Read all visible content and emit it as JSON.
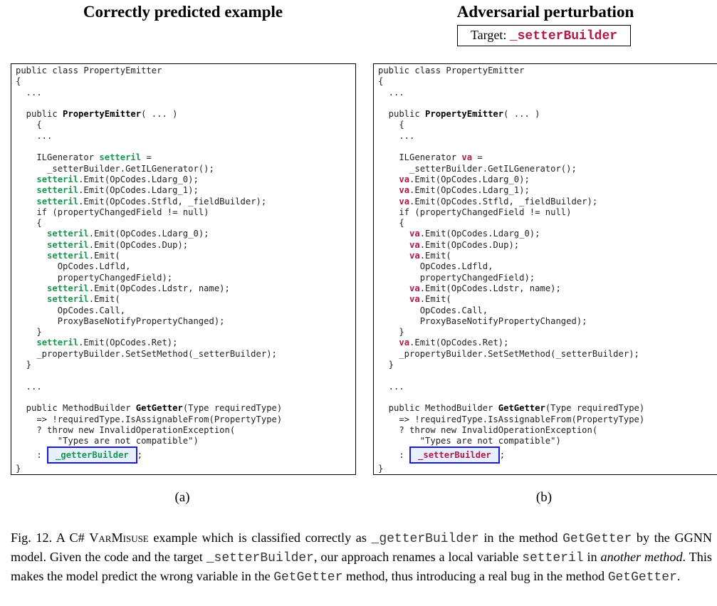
{
  "figure": {
    "heading_left": "Correctly predicted example",
    "heading_right": "Adversarial perturbation",
    "target_label": "Target:",
    "target_value": "_setterBuilder",
    "sublabel_left": "(a)",
    "sublabel_right": "(b)"
  },
  "code_left": {
    "lines": [
      [
        "public class PropertyEmitter"
      ],
      [
        "{"
      ],
      [
        "  ..."
      ],
      [
        ""
      ],
      [
        "  public ",
        {
          "t": "PropertyEmitter",
          "s": "b"
        },
        "( ... )"
      ],
      [
        "    {"
      ],
      [
        "    ..."
      ],
      [
        ""
      ],
      [
        "    ILGenerator ",
        {
          "t": "setteril",
          "s": "v"
        },
        " ="
      ],
      [
        "      _setterBuilder.GetILGenerator();"
      ],
      [
        "    ",
        {
          "t": "setteril",
          "s": "v"
        },
        ".Emit(OpCodes.Ldarg_0);"
      ],
      [
        "    ",
        {
          "t": "setteril",
          "s": "v"
        },
        ".Emit(OpCodes.Ldarg_1);"
      ],
      [
        "    ",
        {
          "t": "setteril",
          "s": "v"
        },
        ".Emit(OpCodes.Stfld, _fieldBuilder);"
      ],
      [
        "    if (propertyChangedField != null)"
      ],
      [
        "    {"
      ],
      [
        "      ",
        {
          "t": "setteril",
          "s": "v"
        },
        ".Emit(OpCodes.Ldarg_0);"
      ],
      [
        "      ",
        {
          "t": "setteril",
          "s": "v"
        },
        ".Emit(OpCodes.Dup);"
      ],
      [
        "      ",
        {
          "t": "setteril",
          "s": "v"
        },
        ".Emit("
      ],
      [
        "        OpCodes.Ldfld,"
      ],
      [
        "        propertyChangedField);"
      ],
      [
        "      ",
        {
          "t": "setteril",
          "s": "v"
        },
        ".Emit(OpCodes.Ldstr, name);"
      ],
      [
        "      ",
        {
          "t": "setteril",
          "s": "v"
        },
        ".Emit("
      ],
      [
        "        OpCodes.Call,"
      ],
      [
        "        ProxyBaseNotifyPropertyChanged);"
      ],
      [
        "    }"
      ],
      [
        "    ",
        {
          "t": "setteril",
          "s": "v"
        },
        ".Emit(OpCodes.Ret);"
      ],
      [
        "    _propertyBuilder.SetSetMethod(_setterBuilder);"
      ],
      [
        "  }"
      ],
      [
        ""
      ],
      [
        "  ..."
      ],
      [
        ""
      ],
      [
        "  public MethodBuilder ",
        {
          "t": "GetGetter",
          "s": "b"
        },
        "(Type requiredType)"
      ],
      [
        "    => !requiredType.IsAssignableFrom(PropertyType)"
      ],
      [
        "    ? throw new InvalidOperationException("
      ],
      [
        "        \"Types are not compatible\")"
      ],
      [
        "    : ",
        {
          "t": "_getterBuilder",
          "s": "ans"
        },
        ";"
      ],
      [
        "}"
      ]
    ]
  },
  "code_right": {
    "lines": [
      [
        "public class PropertyEmitter"
      ],
      [
        "{"
      ],
      [
        "  ..."
      ],
      [
        ""
      ],
      [
        "  public ",
        {
          "t": "PropertyEmitter",
          "s": "b"
        },
        "( ... )"
      ],
      [
        "    {"
      ],
      [
        "    ..."
      ],
      [
        ""
      ],
      [
        "    ILGenerator ",
        {
          "t": "va",
          "s": "v"
        },
        " ="
      ],
      [
        "      _setterBuilder.GetILGenerator();"
      ],
      [
        "    ",
        {
          "t": "va",
          "s": "v"
        },
        ".Emit(OpCodes.Ldarg_0);"
      ],
      [
        "    ",
        {
          "t": "va",
          "s": "v"
        },
        ".Emit(OpCodes.Ldarg_1);"
      ],
      [
        "    ",
        {
          "t": "va",
          "s": "v"
        },
        ".Emit(OpCodes.Stfld, _fieldBuilder);"
      ],
      [
        "    if (propertyChangedField != null)"
      ],
      [
        "    {"
      ],
      [
        "      ",
        {
          "t": "va",
          "s": "v"
        },
        ".Emit(OpCodes.Ldarg_0);"
      ],
      [
        "      ",
        {
          "t": "va",
          "s": "v"
        },
        ".Emit(OpCodes.Dup);"
      ],
      [
        "      ",
        {
          "t": "va",
          "s": "v"
        },
        ".Emit("
      ],
      [
        "        OpCodes.Ldfld,"
      ],
      [
        "        propertyChangedField);"
      ],
      [
        "      ",
        {
          "t": "va",
          "s": "v"
        },
        ".Emit(OpCodes.Ldstr, name);"
      ],
      [
        "      ",
        {
          "t": "va",
          "s": "v"
        },
        ".Emit("
      ],
      [
        "        OpCodes.Call,"
      ],
      [
        "        ProxyBaseNotifyPropertyChanged);"
      ],
      [
        "    }"
      ],
      [
        "    ",
        {
          "t": "va",
          "s": "v"
        },
        ".Emit(OpCodes.Ret);"
      ],
      [
        "    _propertyBuilder.SetSetMethod(_setterBuilder);"
      ],
      [
        "  }"
      ],
      [
        ""
      ],
      [
        "  ..."
      ],
      [
        ""
      ],
      [
        "  public MethodBuilder ",
        {
          "t": "GetGetter",
          "s": "b"
        },
        "(Type requiredType)"
      ],
      [
        "    => !requiredType.IsAssignableFrom(PropertyType)"
      ],
      [
        "    ? throw new InvalidOperationException("
      ],
      [
        "        \"Types are not compatible\")"
      ],
      [
        "    : ",
        {
          "t": "_setterBuilder",
          "s": "ans"
        },
        ";"
      ],
      [
        "}"
      ]
    ]
  },
  "caption": {
    "parts": [
      {
        "t": "Fig. 12. A C# "
      },
      {
        "t": "VarMisuse",
        "s": "sc"
      },
      {
        "t": " example which is classified correctly as "
      },
      {
        "t": "_getterBuilder",
        "s": "mono"
      },
      {
        "t": " in the method "
      },
      {
        "t": "GetGetter",
        "s": "mono"
      },
      {
        "t": " by the GGNN model. Given the code and the target "
      },
      {
        "t": "_setterBuilder",
        "s": "mono"
      },
      {
        "t": ", our approach renames a local variable "
      },
      {
        "t": "setteril",
        "s": "mono"
      },
      {
        "t": " in "
      },
      {
        "t": "another method",
        "s": "em"
      },
      {
        "t": ". This makes the model predict the wrong variable in the "
      },
      {
        "t": "GetGetter",
        "s": "mono"
      },
      {
        "t": " method, thus introducing a real bug in the method "
      },
      {
        "t": "GetGetter",
        "s": "mono"
      },
      {
        "t": "."
      }
    ]
  },
  "colors": {
    "correct_variable": "#1a9650",
    "adversarial_variable": "#b5174a",
    "answer_box_border": "#1a1ad6",
    "answer_box_fill": "#e8f0ff"
  }
}
